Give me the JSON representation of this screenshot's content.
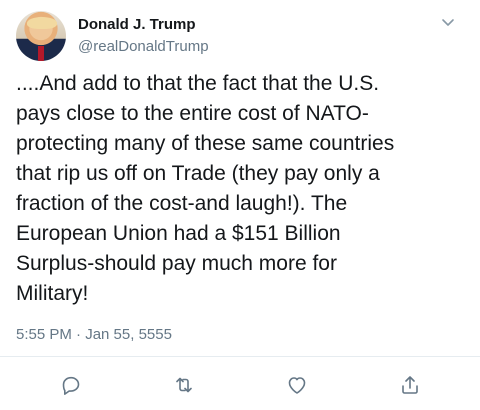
{
  "author": {
    "name": "Donald J. Trump",
    "handle": "@realDonaldTrump"
  },
  "tweet": {
    "text": "....And add to that the fact that the U.S.\npays close to the entire cost of NATO-\nprotecting many of these same countries\nthat rip us off on Trade (they pay only a\nfraction of the cost-and laugh!). The\nEuropean Union had a $151 Billion\nSurplus-should pay much more for\nMilitary!",
    "timestamp": "5:55 PM · Jan 55, 5555"
  },
  "icons": {
    "menu": "chevron-down-icon",
    "reply": "reply-icon",
    "retweet": "retweet-icon",
    "like": "heart-icon",
    "share": "share-icon"
  },
  "colors": {
    "text": "#14171a",
    "secondary": "#657786",
    "icon": "#657786"
  }
}
